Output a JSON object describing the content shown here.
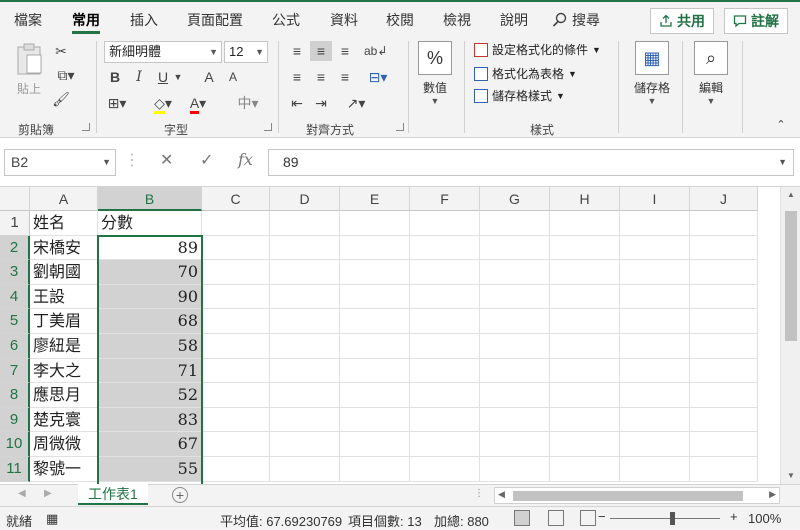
{
  "ribbon_tabs": [
    "檔案",
    "常用",
    "插入",
    "頁面配置",
    "公式",
    "資料",
    "校閱",
    "檢視",
    "說明"
  ],
  "active_tab": "常用",
  "search_label": "搜尋",
  "share_label": "共用",
  "comments_label": "註解",
  "clipboard": {
    "paste_label": "貼上",
    "group_label": "剪貼簿"
  },
  "font": {
    "name": "新細明體",
    "size": "12",
    "group_label": "字型",
    "bold": "B",
    "italic": "I",
    "underline": "U",
    "grow": "A",
    "shrink": "A",
    "font_color": "A",
    "phonetic": "中"
  },
  "alignment": {
    "group_label": "對齊方式"
  },
  "number": {
    "format_label": "數值",
    "percent_symbol": "%"
  },
  "styles": {
    "conditional_label": "設定格式化的條件",
    "table_label": "格式化為表格",
    "cell_styles_label": "儲存格樣式",
    "group_label": "樣式"
  },
  "cells_label": "儲存格",
  "editing_label": "編輯",
  "formula_bar": {
    "name_box": "B2",
    "value": "89",
    "fx": "fx"
  },
  "columns": [
    "A",
    "B",
    "C",
    "D",
    "E",
    "F",
    "G",
    "H",
    "I",
    "J"
  ],
  "rows": [
    {
      "num": "1",
      "a": "姓名",
      "b": "分數"
    },
    {
      "num": "2",
      "a": "宋橋安",
      "b": "89"
    },
    {
      "num": "3",
      "a": "劉朝國",
      "b": "70"
    },
    {
      "num": "4",
      "a": "王設",
      "b": "90"
    },
    {
      "num": "5",
      "a": "丁美眉",
      "b": "68"
    },
    {
      "num": "6",
      "a": "廖紐是",
      "b": "58"
    },
    {
      "num": "7",
      "a": "李大之",
      "b": "71"
    },
    {
      "num": "8",
      "a": "應思月",
      "b": "52"
    },
    {
      "num": "9",
      "a": "楚克寰",
      "b": "83"
    },
    {
      "num": "10",
      "a": "周微微",
      "b": "67"
    },
    {
      "num": "11",
      "a": "黎號一",
      "b": "55"
    }
  ],
  "sheet_tab": "工作表1",
  "status": {
    "ready": "就緒",
    "average": "平均值: 67.69230769",
    "count": "項目個數: 13",
    "sum": "加總: 880",
    "zoom": "100%",
    "zoom_minus": "−",
    "zoom_plus": "+"
  },
  "colors": {
    "accent": "#217346",
    "selection": "#d2d2d2"
  }
}
